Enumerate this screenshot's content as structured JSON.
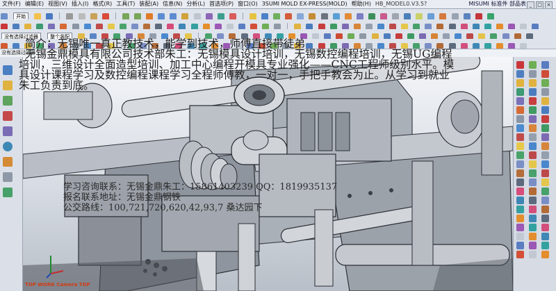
{
  "menubar": {
    "items": [
      "文件(F)",
      "编辑(E)",
      "视图(V)",
      "插入(I)",
      "格式(R)",
      "工具(T)",
      "装配(A)",
      "信息(N)",
      "分析(L)",
      "首选项(P)",
      "窗口(O)",
      "3SUMI MOLD EX-PRESS(MOLD)",
      "帮助(H)"
    ],
    "title_text": "HB_MODEL0.V3.5?",
    "misumi": "MISUMI 标准件  部品表",
    "window_buttons": [
      "_",
      "□",
      "×"
    ]
  },
  "toolbar": {
    "start_label": "开始",
    "filter_label": "整个装配",
    "hint_label": "没有选择过滤器"
  },
  "overlay": {
    "lines": [
      "简介：无锡唯一真正教技术，能学到技术，师傅直接带徒弟",
      "无锡金鼎模具有限公司技术部朱工：无锡模具设计培训，无锡数控编程培训，无锡UG编程",
      "培训，三维设计全面造型培训、加工中心编程开模具专业强化——CNC工程师级别水平。模",
      "具设计课程学习及数控编程课程学习全程师傅教，一对一，手把手教会为止。从学习到就业",
      "朱工负责到底。"
    ],
    "contact": [
      "学习咨询联系：无锡金鼎朱工：15861403239 QQ：1819935137",
      "报名联系地址：无锡金鼎钢铁",
      "公交路线：100,721,720,620,42,93,7 桑达园下"
    ]
  },
  "viewport": {
    "camera_label": "TOP WORK Camera TOP"
  },
  "colors": {
    "model_face": "#9aa0a8",
    "model_light": "#d8dbe0",
    "model_dark": "#3d4148",
    "accent": "#d23a13"
  }
}
